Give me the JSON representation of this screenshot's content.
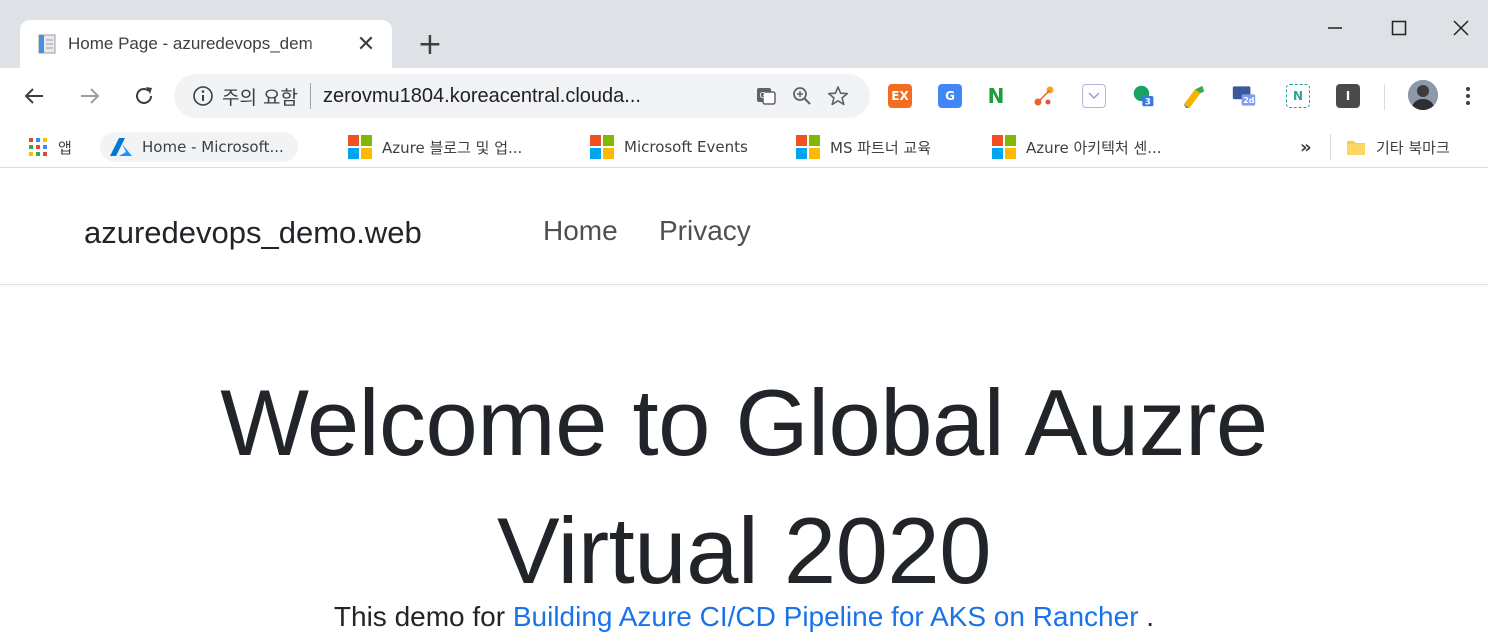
{
  "browser": {
    "tab": {
      "title": "Home Page - azuredevops_dem",
      "close_glyph": "✕"
    },
    "new_tab_glyph": "+",
    "window_controls": {
      "minimize": "–",
      "maximize": "☐",
      "close": "✕"
    },
    "toolbar": {
      "security_warning": "주의 요함",
      "url": "zerovmu1804.koreacentral.clouda..."
    },
    "extensions": [
      {
        "name": "ex-extension",
        "label": "EX",
        "color": "#f36d21"
      },
      {
        "name": "google-translate-extension",
        "label": "G",
        "color": "#4285f4"
      },
      {
        "name": "n-extension",
        "label": "N",
        "color": "#1e9e3a"
      },
      {
        "name": "network-extension",
        "label": "",
        "color": "#ea8a3b"
      },
      {
        "name": "pocket-extension",
        "label": "",
        "color": "#c5c5ff"
      },
      {
        "name": "chat-extension",
        "label": "3",
        "color": "#1aa260"
      },
      {
        "name": "tool-extension",
        "label": "",
        "color": "#f4b400"
      },
      {
        "name": "desktop-extension",
        "label": "2d",
        "color": "#5b7bd5"
      },
      {
        "name": "n-bracket-extension",
        "label": "N",
        "color": "#26a69a"
      },
      {
        "name": "i-extension",
        "label": "I",
        "color": "#4a4a4a"
      }
    ],
    "bookmarks": {
      "apps_label": "앱",
      "items": [
        {
          "label": "Home - Microsoft..."
        },
        {
          "label": "Azure 블로그 및 업..."
        },
        {
          "label": "Microsoft Events"
        },
        {
          "label": "MS 파트너 교육"
        },
        {
          "label": "Azure 아키텍처 센..."
        }
      ],
      "overflow": "»",
      "other_label": "기타 북마크"
    }
  },
  "page": {
    "brand": "azuredevops_demo.web",
    "nav": [
      "Home",
      "Privacy"
    ],
    "hero_line1": "Welcome to Global Auzre",
    "hero_line2": "Virtual 2020",
    "lead_prefix": "This demo for ",
    "lead_link": "Building Azure CI/CD Pipeline for AKS on Rancher",
    "lead_suffix": " ."
  },
  "colors": {
    "link": "#1a73e8",
    "tabstrip": "#dee1e6",
    "omnibox": "#f1f3f4",
    "ms_red": "#f25022",
    "ms_green": "#7fba00",
    "ms_blue": "#00a4ef",
    "ms_yellow": "#ffb900"
  }
}
